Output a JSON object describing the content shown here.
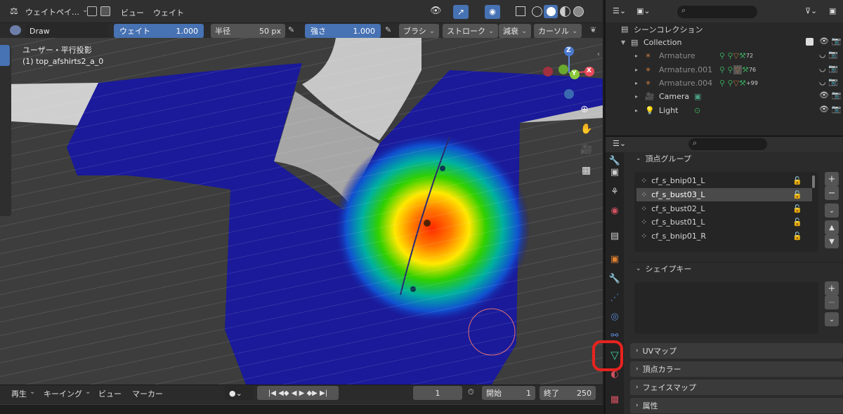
{
  "header": {
    "mode_label": "ウェイトペイ…",
    "menu_view": "ビュー",
    "menu_weight": "ウェイト"
  },
  "toolbar": {
    "brush_name": "Draw",
    "weight_label": "ウェイト",
    "weight_value": "1.000",
    "radius_label": "半径",
    "radius_value": "50 px",
    "strength_label": "強さ",
    "strength_value": "1.000",
    "brush_menu": "ブラシ",
    "stroke_menu": "ストローク",
    "falloff_menu": "減衰",
    "cursor_menu": "カーソル"
  },
  "viewport": {
    "view_name": "ユーザー・平行投影",
    "object_name": "(1) top_afshirts2_a_0",
    "gizmo_x": "X",
    "gizmo_y": "Y",
    "gizmo_z": "Z"
  },
  "outliner": {
    "scene_collection": "シーンコレクション",
    "items": [
      {
        "name": "Collection",
        "badge": ""
      },
      {
        "name": "Armature",
        "badge": "72"
      },
      {
        "name": "Armature.001",
        "badge": "76"
      },
      {
        "name": "Armature.004",
        "badge": "+99"
      },
      {
        "name": "Camera",
        "badge": ""
      },
      {
        "name": "Light",
        "badge": ""
      }
    ]
  },
  "properties": {
    "vertex_groups_title": "頂点グループ",
    "vertex_groups": [
      "cf_s_bnip01_L",
      "cf_s_bust03_L",
      "cf_s_bust02_L",
      "cf_s_bust01_L",
      "cf_s_bnip01_R"
    ],
    "shape_keys_title": "シェイプキー",
    "uv_title": "UVマップ",
    "vcolor_title": "頂点カラー",
    "facemap_title": "フェイスマップ",
    "attr_title": "属性"
  },
  "timeline": {
    "playback": "再生",
    "keying": "キーイング",
    "view": "ビュー",
    "marker": "マーカー",
    "current_frame": "1",
    "start_label": "開始",
    "start_value": "1",
    "end_label": "終了",
    "end_value": "250"
  },
  "colors": {
    "accent": "#4772b3",
    "highlight_circle": "#e8231f",
    "mesh_blue": "#1a1a9a"
  }
}
